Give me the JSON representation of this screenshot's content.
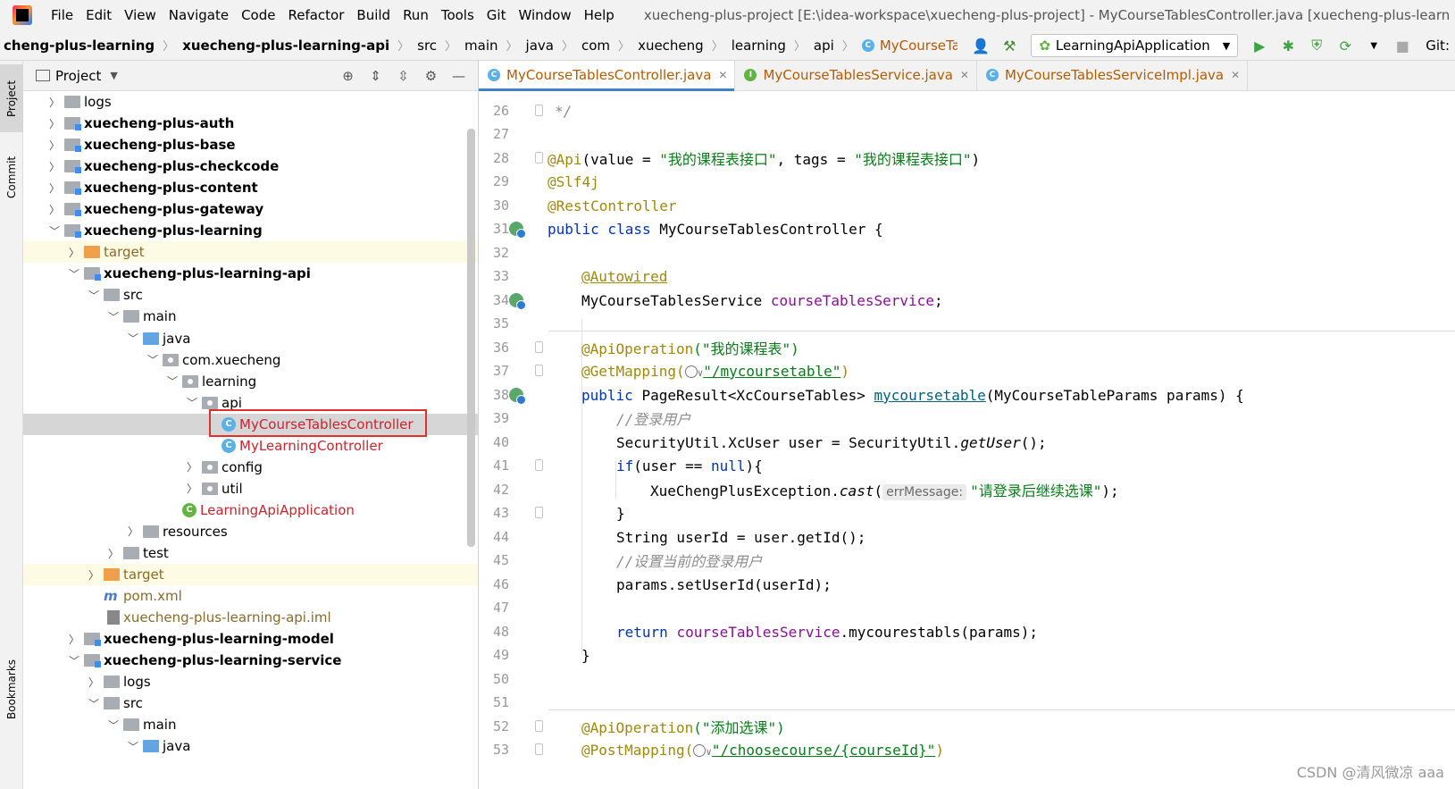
{
  "menu": {
    "items": [
      "File",
      "Edit",
      "View",
      "Navigate",
      "Code",
      "Refactor",
      "Build",
      "Run",
      "Tools",
      "Git",
      "Window",
      "Help"
    ],
    "window_title": "xuecheng-plus-project [E:\\idea-workspace\\xuecheng-plus-project] - MyCourseTablesController.java [xuecheng-plus-learn"
  },
  "nav": {
    "crumbs": [
      "cheng-plus-learning",
      "xuecheng-plus-learning-api",
      "src",
      "main",
      "java",
      "com",
      "xuecheng",
      "learning",
      "api"
    ],
    "class_crumb": "MyCourseTablesController",
    "run_config": "LearningApiApplication",
    "git_label": "Git:"
  },
  "stripe": {
    "project": "Project",
    "commit": "Commit",
    "bookmarks": "Bookmarks"
  },
  "project_panel": {
    "title": "Project",
    "tree": [
      {
        "label": "logs",
        "icon": "folder"
      },
      {
        "label": "xuecheng-plus-auth",
        "icon": "module"
      },
      {
        "label": "xuecheng-plus-base",
        "icon": "module"
      },
      {
        "label": "xuecheng-plus-checkcode",
        "icon": "module"
      },
      {
        "label": "xuecheng-plus-content",
        "icon": "module"
      },
      {
        "label": "xuecheng-plus-gateway",
        "icon": "module"
      },
      {
        "label": "xuecheng-plus-learning",
        "icon": "module"
      },
      {
        "label": "target",
        "icon": "folder-orange"
      },
      {
        "label": "xuecheng-plus-learning-api",
        "icon": "module"
      },
      {
        "label": "src",
        "icon": "folder"
      },
      {
        "label": "main",
        "icon": "folder"
      },
      {
        "label": "java",
        "icon": "folder-blue"
      },
      {
        "label": "com.xuecheng",
        "icon": "package"
      },
      {
        "label": "learning",
        "icon": "package"
      },
      {
        "label": "api",
        "icon": "package"
      },
      {
        "label": "MyCourseTablesController",
        "icon": "class"
      },
      {
        "label": "MyLearningController",
        "icon": "class"
      },
      {
        "label": "config",
        "icon": "package"
      },
      {
        "label": "util",
        "icon": "package"
      },
      {
        "label": "LearningApiApplication",
        "icon": "spring-class"
      },
      {
        "label": "resources",
        "icon": "folder"
      },
      {
        "label": "test",
        "icon": "folder"
      },
      {
        "label": "target",
        "icon": "folder-orange"
      },
      {
        "label": "pom.xml",
        "icon": "maven"
      },
      {
        "label": "xuecheng-plus-learning-api.iml",
        "icon": "iml"
      },
      {
        "label": "xuecheng-plus-learning-model",
        "icon": "module"
      },
      {
        "label": "xuecheng-plus-learning-service",
        "icon": "module"
      },
      {
        "label": "logs",
        "icon": "folder"
      },
      {
        "label": "src",
        "icon": "folder"
      },
      {
        "label": "main",
        "icon": "folder"
      },
      {
        "label": "java",
        "icon": "folder-blue"
      }
    ]
  },
  "editor": {
    "tabs": [
      {
        "label": "MyCourseTablesController.java",
        "icon": "C",
        "active": true
      },
      {
        "label": "MyCourseTablesService.java",
        "icon": "I",
        "active": false
      },
      {
        "label": "MyCourseTablesServiceImpl.java",
        "icon": "C",
        "active": false
      }
    ],
    "line_numbers": [
      "26",
      "27",
      "28",
      "29",
      "30",
      "31",
      "32",
      "33",
      "34",
      "35",
      "36",
      "37",
      "38",
      "39",
      "40",
      "41",
      "42",
      "43",
      "44",
      "45",
      "46",
      "47",
      "48",
      "49",
      "50",
      "51",
      "52",
      "53"
    ],
    "code": {
      "l26": "*/",
      "l28_ann": "@Api",
      "l28_open": "(value = ",
      "l28_str1": "\"我的课程表接口\"",
      "l28_mid": ", tags = ",
      "l28_str2": "\"我的课程表接口\"",
      "l28_close": ")",
      "l29": "@Slf4j",
      "l30": "@RestController",
      "l31_kw": "public class",
      "l31_rest": " MyCourseTablesController {",
      "l33": "@Autowired",
      "l34_type": "MyCourseTablesService ",
      "l34_field": "courseTablesService",
      "l34_end": ";",
      "l36_ann": "@ApiOperation",
      "l36_str": "(\"我的课程表\")",
      "l37_ann": "@GetMapping(",
      "l37_str": "\"/mycoursetable\"",
      "l37_end": ")",
      "l38_kw": "public ",
      "l38_type": "PageResult<XcCourseTables> ",
      "l38_method": "mycoursetable",
      "l38_rest": "(MyCourseTableParams params) {",
      "l39": "//登录用户",
      "l40_a": "SecurityUtil.XcUser user = SecurityUtil.",
      "l40_b": "getUser",
      "l40_c": "();",
      "l41_kw": "if",
      "l41_a": "(user == ",
      "l41_kw2": "null",
      "l41_b": "){",
      "l42_a": "XueChengPlusException.",
      "l42_b": "cast",
      "l42_c": "(",
      "l42_hint": "errMessage:",
      "l42_str": "\"请登录后继续选课\"",
      "l42_end": ");",
      "l43": "}",
      "l44": "String userId = user.getId();",
      "l45": "//设置当前的登录用户",
      "l46": "params.setUserId(userId);",
      "l48_kw": "return ",
      "l48_field": "courseTablesService",
      "l48_rest": ".mycourestabls(params);",
      "l49": "}",
      "l52_ann": "@ApiOperation",
      "l52_str": "(\"添加选课\")",
      "l53_ann": "@PostMapping(",
      "l53_str": "\"/choosecourse/{courseId}\"",
      "l53_end": ")"
    }
  },
  "watermark": "CSDN @清风微凉 aaa",
  "colors": {
    "accent": "#4083c9",
    "highlight_box": "#e0312f",
    "class_name": "#b35c00"
  }
}
